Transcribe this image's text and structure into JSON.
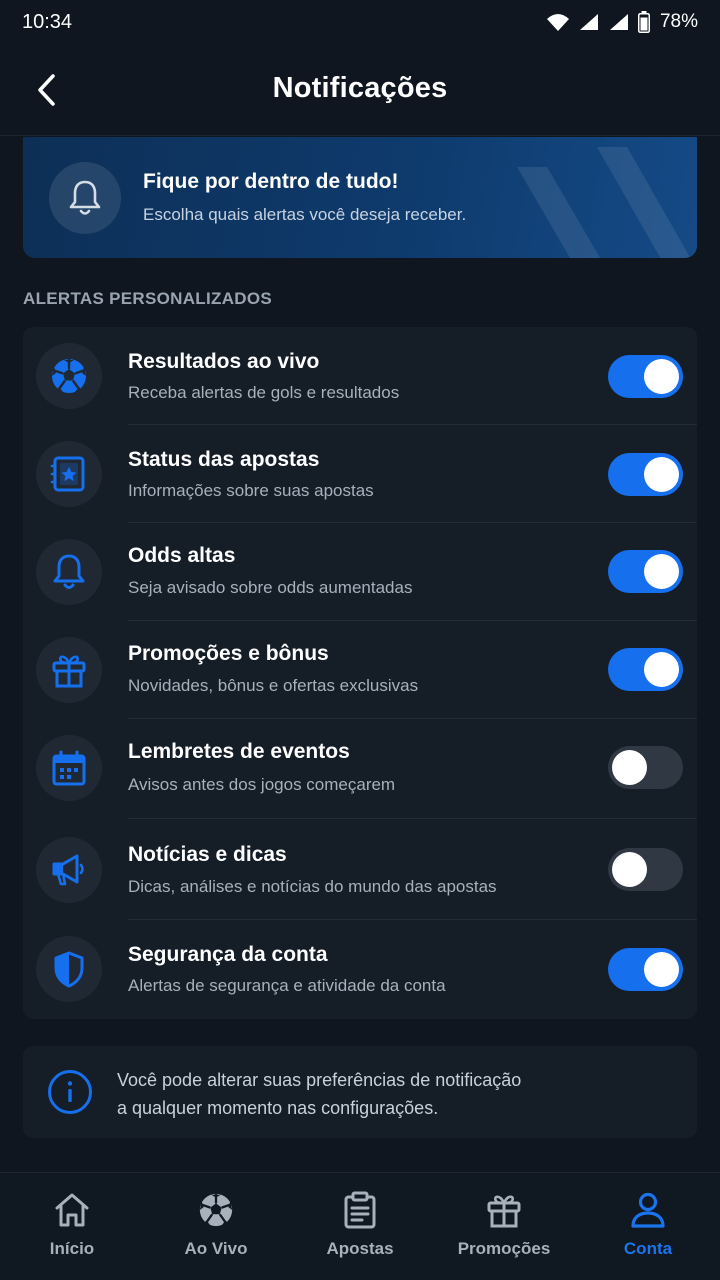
{
  "status_bar": {
    "time": "10:34",
    "battery": "78%"
  },
  "header": {
    "title": "Notificações",
    "back_icon": "chevron-left-icon"
  },
  "banner": {
    "title": "Fique por dentro de tudo!",
    "subtitle": "Escolha quais alertas você deseja receber.",
    "icon": "bell-icon"
  },
  "section": {
    "label": "ALERTAS PERSONALIZADOS"
  },
  "alerts": [
    {
      "title": "Resultados ao vivo",
      "subtitle": "Receba alertas de gols e resultados",
      "icon": "soccer-ball-icon",
      "enabled": true
    },
    {
      "title": "Status das apostas",
      "subtitle": "Informações sobre suas apostas",
      "icon": "ticket-star-icon",
      "enabled": true
    },
    {
      "title": "Odds altas",
      "subtitle": "Seja avisado sobre odds aumentadas",
      "icon": "bell-icon",
      "enabled": true
    },
    {
      "title": "Promoções e bônus",
      "subtitle": "Novidades, bônus e ofertas exclusivas",
      "icon": "gift-icon",
      "enabled": true
    },
    {
      "title": "Lembretes de eventos",
      "subtitle": "Avisos antes dos jogos começarem",
      "icon": "calendar-icon",
      "enabled": false
    },
    {
      "title": "Notícias e dicas",
      "subtitle": "Dicas, análises e notícias do mundo das apostas",
      "icon": "megaphone-icon",
      "enabled": false
    },
    {
      "title": "Segurança da conta",
      "subtitle": "Alertas de segurança e atividade da conta",
      "icon": "shield-icon",
      "enabled": true
    }
  ],
  "info": {
    "line1": "Você pode alterar suas preferências de notificação",
    "line2": "a qualquer momento nas configurações.",
    "icon": "info-icon"
  },
  "bottom_nav": [
    {
      "label": "Início",
      "icon": "home-icon",
      "active": false
    },
    {
      "label": "Ao Vivo",
      "icon": "soccer-ball-icon",
      "active": false
    },
    {
      "label": "Apostas",
      "icon": "clipboard-icon",
      "active": false
    },
    {
      "label": "Promoções",
      "icon": "gift-icon",
      "active": false
    },
    {
      "label": "Conta",
      "icon": "user-icon",
      "active": true
    }
  ],
  "colors": {
    "accent": "#1670ee",
    "background": "#0f161f",
    "card": "#151d27",
    "toggle_off": "#2f3843"
  }
}
